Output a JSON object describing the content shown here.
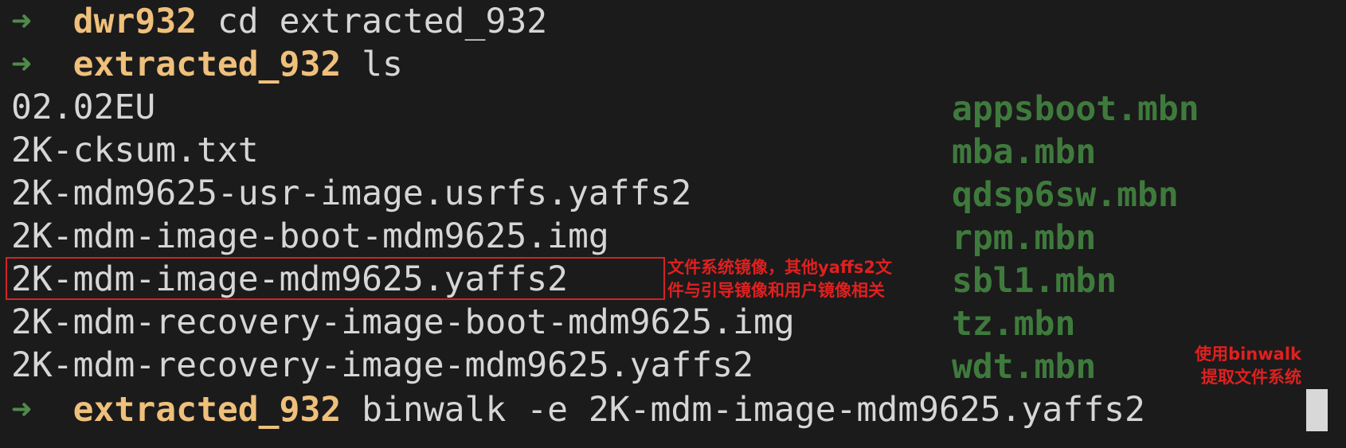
{
  "terminal": {
    "prompt_symbol": "➜",
    "lines": [
      {
        "dir": "dwr932",
        "command": "cd extracted_932"
      },
      {
        "dir": "extracted_932",
        "command": "ls"
      }
    ],
    "left_files": [
      "02.02EU",
      "2K-cksum.txt",
      "2K-mdm9625-usr-image.usrfs.yaffs2",
      "2K-mdm-image-boot-mdm9625.img",
      "2K-mdm-image-mdm9625.yaffs2",
      "2K-mdm-recovery-image-boot-mdm9625.img",
      "2K-mdm-recovery-image-mdm9625.yaffs2"
    ],
    "right_files": [
      "appsboot.mbn",
      "mba.mbn",
      "qdsp6sw.mbn",
      "rpm.mbn",
      "sbl1.mbn",
      "tz.mbn",
      "wdt.mbn"
    ],
    "final_prompt": {
      "dir": "extracted_932",
      "command": "binwalk -e 2K-mdm-image-mdm9625.yaffs2"
    }
  },
  "annotations": {
    "filesystem_note_line1": "文件系统镜像，其他yaffs2文",
    "filesystem_note_line2": "件与引导镜像和用户镜像相关",
    "binwalk_note_line1": "使用binwalk",
    "binwalk_note_line2": "提取文件系统",
    "color": "#e02020"
  },
  "colors": {
    "background": "#1b1b1b",
    "prompt_arrow": "#4f8a4a",
    "directory": "#efc07b",
    "text": "#d6d6d6",
    "mbn_files": "#3f7a3d"
  }
}
